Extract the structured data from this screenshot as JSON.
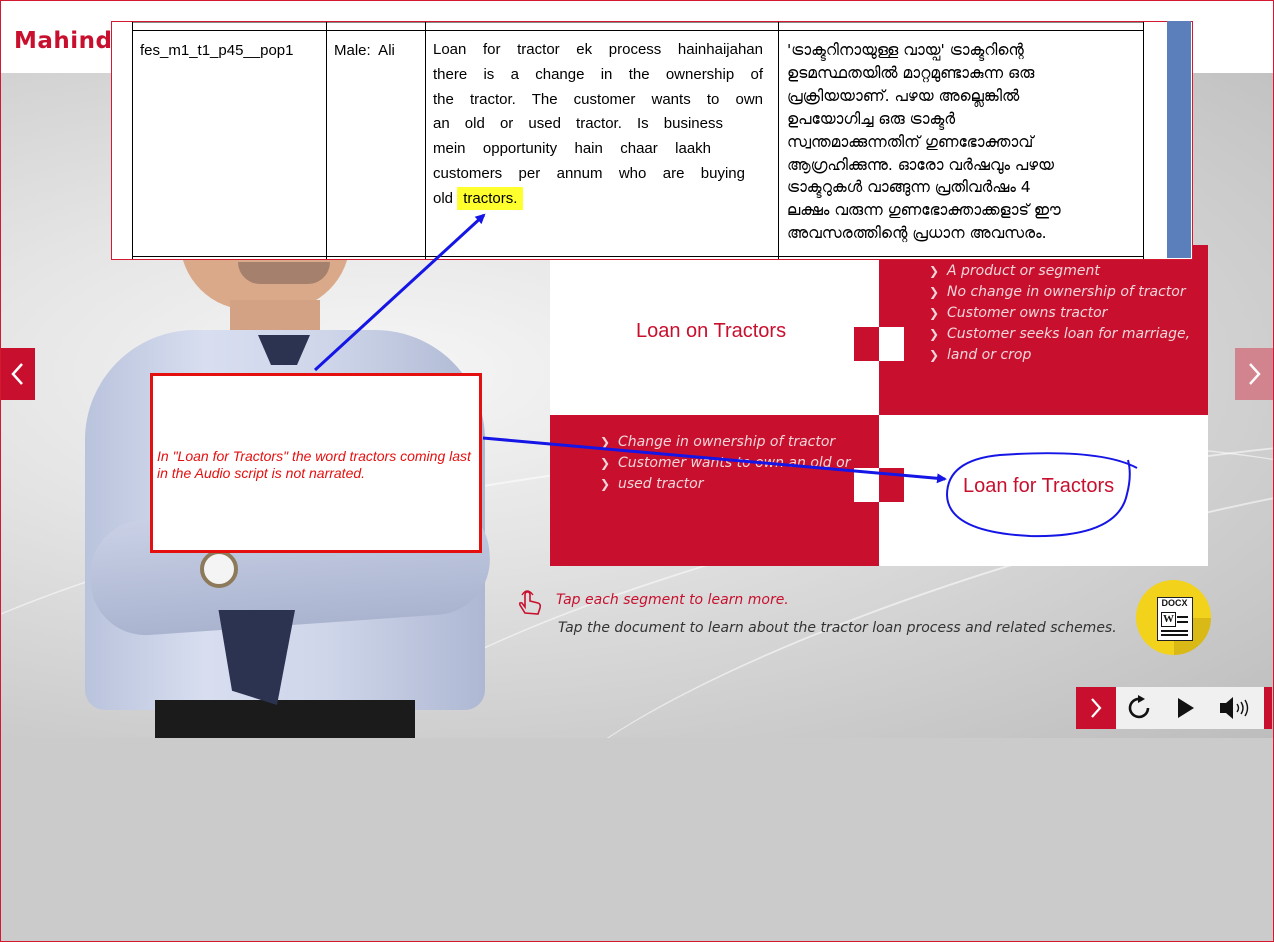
{
  "app": {
    "logo_text": "Mahindra",
    "brand_color": "#c8102e"
  },
  "navigation": {
    "prev_icon": "chevron-left-icon",
    "next_icon": "chevron-right-icon"
  },
  "segments": {
    "loan_on_tractors": {
      "title": "Loan on Tractors",
      "bullets": [
        "A product or segment",
        "No change in ownership of tractor",
        "Customer owns tractor",
        "Customer seeks loan for marriage,",
        "land or crop"
      ]
    },
    "loan_for_tractors": {
      "title": "Loan for Tractors",
      "bullets": [
        "Change in ownership of tractor",
        "Customer wants to own an old or",
        "used tractor"
      ]
    }
  },
  "hints": {
    "tap_segment": "Tap each segment to learn more.",
    "tap_document": "Tap the document to learn about the tractor loan process and related schemes."
  },
  "document_icon": {
    "label": "DOCX",
    "glyph": "W"
  },
  "player_controls": [
    "next-icon",
    "replay-icon",
    "play-icon",
    "volume-icon"
  ],
  "review_table": {
    "id": "fes_m1_t1_p45__pop1",
    "speaker": "Male:  Ali",
    "script_lines": [
      "Loan for tractor ek process hainhaijahan",
      "there is a change in the ownership of",
      "the tractor. The customer wants to own",
      "an old or used tractor. Is business",
      "mein opportunity hain chaar laakh",
      "customers per annum who are buying",
      "old"
    ],
    "highlighted_word": "tractors.",
    "malayalam_lines": [
      "'ട്രാക്ടറിനായുള്ള വായ്പ' ട്രാക്ടറിന്റെ",
      "ഉടമസ്ഥതയിൽ മാറ്റമുണ്ടാകുന്ന ഒരു",
      "പ്രക്രിയയാണ്. പഴയ അല്ലെങ്കിൽ",
      "ഉപയോഗിച്ച ഒരു ട്രാക്ടർ",
      "സ്വന്തമാക്കുന്നതിന് ഗുണഭോക്താവ്",
      "ആഗ്രഹിക്കുന്നു. ഓരോ വർഷവും പഴയ",
      "ട്രാക്ടറുകൾ വാങ്ങുന്ന പ്രതിവർഷം 4",
      "ലക്ഷം വരുന്ന ഗുണഭോക്താക്കളാട് ഈ",
      "അവസരത്തിന്റെ പ്രധാന അവസരം."
    ]
  },
  "review_note": {
    "text": "In \"Loan for Tractors\" the word tractors coming last in the Audio script is  not narrated."
  }
}
